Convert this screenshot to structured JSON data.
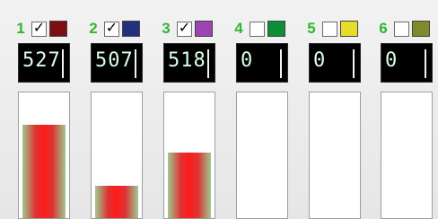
{
  "channels": [
    {
      "number": "1",
      "checked": true,
      "swatch_color": "#7b0d13",
      "value": "527",
      "level": 0.74
    },
    {
      "number": "2",
      "checked": true,
      "swatch_color": "#24307d",
      "value": "507",
      "level": 0.26
    },
    {
      "number": "3",
      "checked": true,
      "swatch_color": "#9c44b4",
      "value": "518",
      "level": 0.52
    },
    {
      "number": "4",
      "checked": false,
      "swatch_color": "#0d8e35",
      "value": "0",
      "level": 0.0
    },
    {
      "number": "5",
      "checked": false,
      "swatch_color": "#e6dc2a",
      "value": "0",
      "level": 0.0
    },
    {
      "number": "6",
      "checked": false,
      "swatch_color": "#7f8a2a",
      "value": "0",
      "level": 0.0
    }
  ],
  "colors": {
    "channel_number": "#2fb62f",
    "display_background": "#000000",
    "display_text": "#d9ffe8",
    "meter_fill": "#ff1b1b"
  },
  "icons": {
    "checkbox_checked": "check-icon"
  }
}
